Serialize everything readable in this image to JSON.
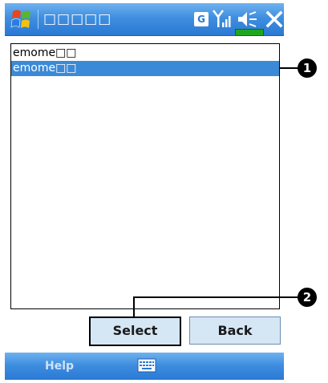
{
  "titlebar": {
    "title": "□□□□□",
    "tray_g": "G",
    "colors": {
      "bar": "#3f8ee0",
      "battery": "#1ea71e"
    },
    "icons": [
      "windows-start-icon",
      "signal-icon",
      "volume-muted-icon",
      "battery-icon",
      "close-icon"
    ]
  },
  "list": {
    "items": [
      {
        "label": "emome□□",
        "selected": false
      },
      {
        "label": "emome□□",
        "selected": true
      }
    ],
    "selection_color": "#3a8ad8"
  },
  "buttons": {
    "select_label": "Select",
    "back_label": "Back"
  },
  "menubar": {
    "help_label": "Help",
    "keyboard_icon": "keyboard-icon"
  },
  "callouts": {
    "one": "1",
    "two": "2"
  }
}
